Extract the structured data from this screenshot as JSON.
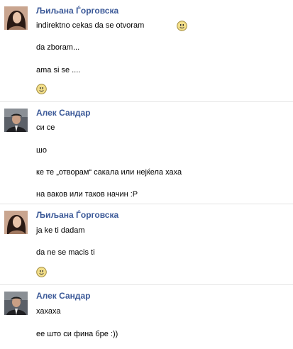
{
  "messages": [
    {
      "sender": "Љиљана Ѓорговска",
      "lines": [
        "indirektno cekas da se otvoram",
        "da zboram...",
        "ama si se ...."
      ],
      "emoticons": [
        "smile-face-icon",
        "smile-face-icon"
      ]
    },
    {
      "sender": "Алек Сандар",
      "lines": [
        "си се",
        "шо",
        "ке те „отворам“ сакала или нејќела хаха",
        "на ваков или таков начин :P"
      ]
    },
    {
      "sender": "Љиљана Ѓорговска",
      "lines": [
        "ja ke ti dadam",
        "da ne se macis ti"
      ],
      "emoticons": [
        "smile-face-icon"
      ]
    },
    {
      "sender": "Алек Сандар",
      "lines": [
        "хахаха",
        "ее што си фина бре :))"
      ]
    }
  ],
  "colors": {
    "name": "#3b5998",
    "emoticon": "#f3df8a"
  }
}
